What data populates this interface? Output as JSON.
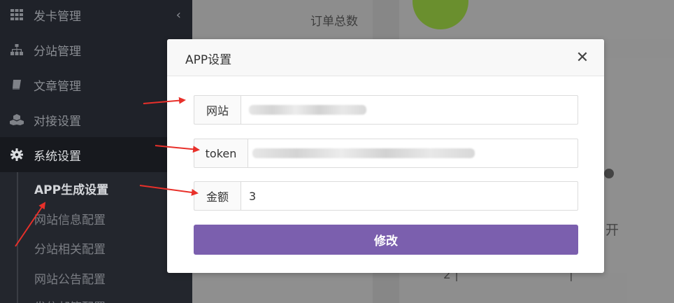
{
  "sidebar": {
    "items": [
      {
        "label": "发卡管理",
        "icon": "grid-icon"
      },
      {
        "label": "分站管理",
        "icon": "sitemap-icon"
      },
      {
        "label": "文章管理",
        "icon": "book-icon"
      },
      {
        "label": "对接设置",
        "icon": "cubes-icon"
      },
      {
        "label": "系统设置",
        "icon": "gear-icon"
      }
    ],
    "submenu": [
      {
        "label": "APP生成设置"
      },
      {
        "label": "网站信息配置"
      },
      {
        "label": "分站相关配置"
      },
      {
        "label": "网站公告配置"
      },
      {
        "label": "发信邮箱配置"
      }
    ]
  },
  "background": {
    "order_total_label": "订单总数",
    "peek_1": "2 |",
    "peek_2": "|",
    "peek_3": "开"
  },
  "modal": {
    "title": "APP设置",
    "close_symbol": "✕",
    "fields": [
      {
        "label": "网站"
      },
      {
        "label": "token"
      },
      {
        "label": "金额",
        "value": "3"
      }
    ],
    "submit_label": "修改"
  },
  "colors": {
    "sidebar_bg": "#1f2229",
    "submit_bg": "#7b5fae",
    "arrow": "#e8302a",
    "status_green": "#6a8f2e"
  }
}
